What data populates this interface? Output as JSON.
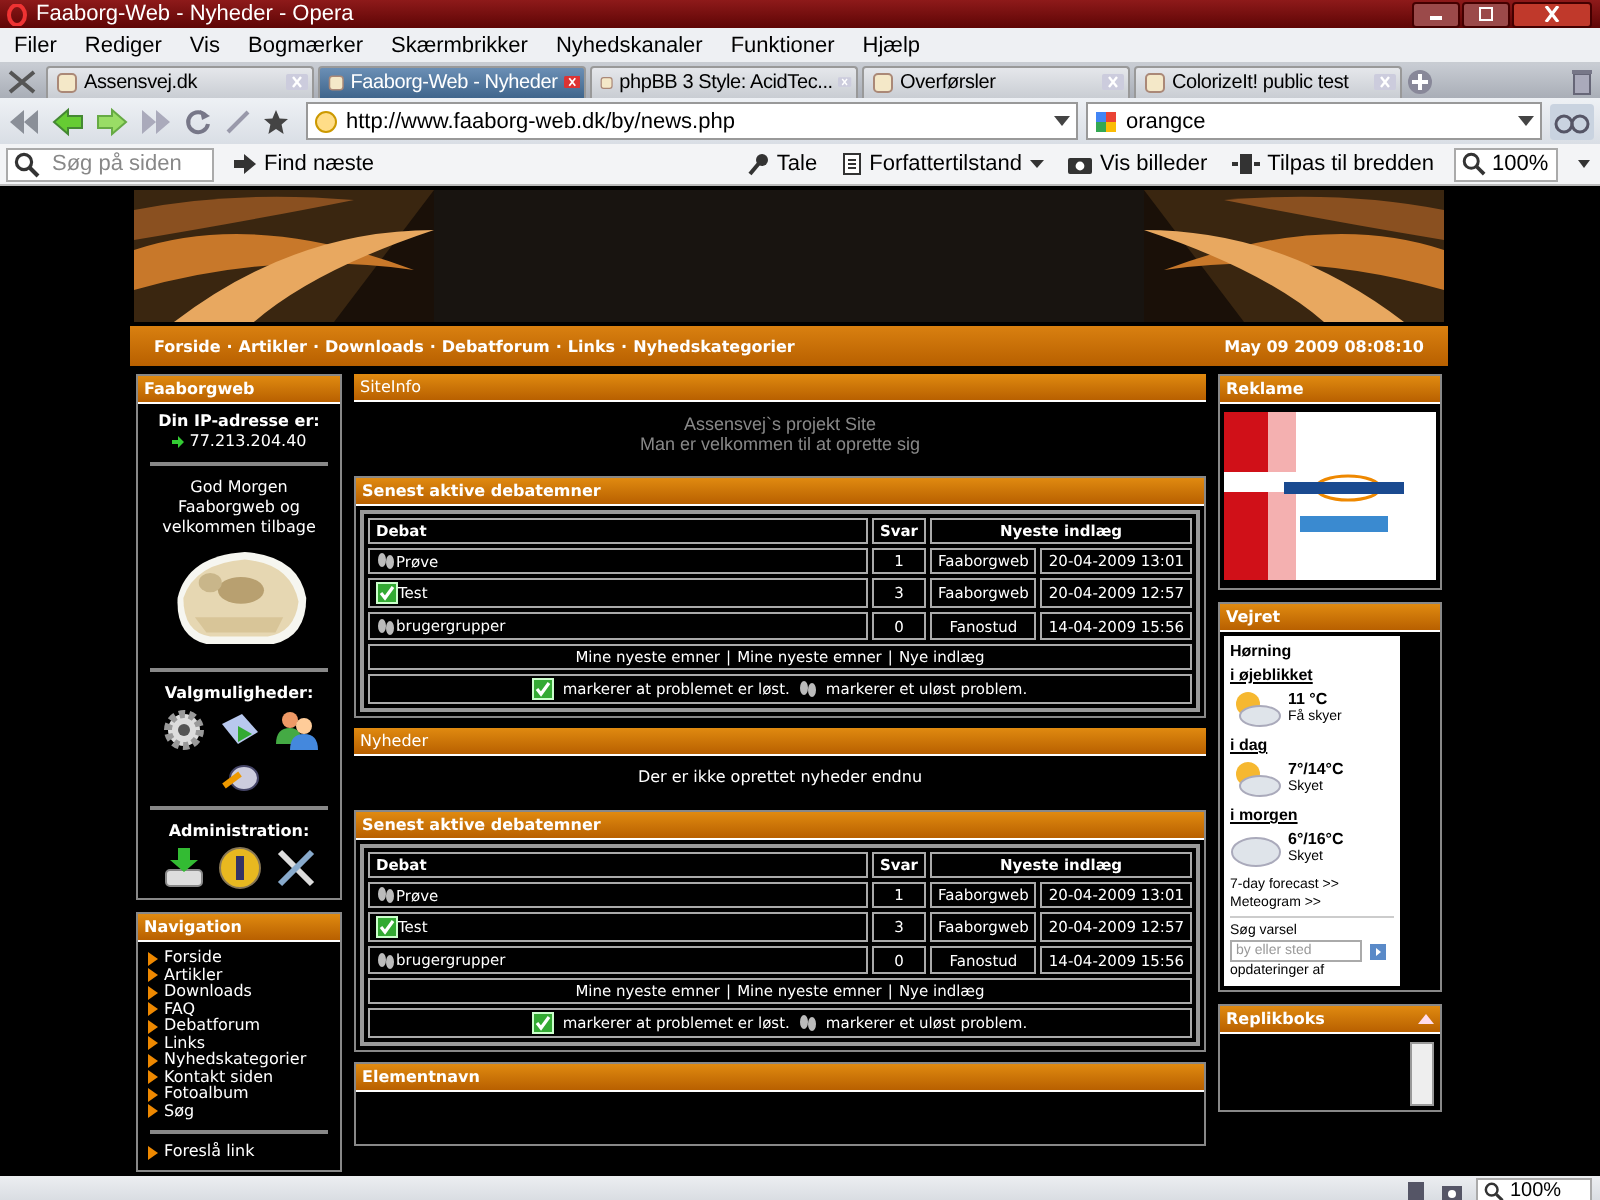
{
  "window": {
    "title": "Faaborg-Web - Nyheder - Opera"
  },
  "menu": [
    "Filer",
    "Rediger",
    "Vis",
    "Bogmærker",
    "Skærmbrikker",
    "Nyhedskanaler",
    "Funktioner",
    "Hjælp"
  ],
  "tabs": [
    {
      "label": "Assensvej.dk",
      "selected": false
    },
    {
      "label": "Faaborg-Web - Nyheder",
      "selected": true
    },
    {
      "label": "phpBB 3 Style: AcidTec...",
      "selected": false
    },
    {
      "label": "Overførsler",
      "selected": false
    },
    {
      "label": "ColorizeIt! public test",
      "selected": false
    }
  ],
  "address": {
    "url": "http://www.faaborg-web.dk/by/news.php",
    "search": "orangce"
  },
  "findbar": {
    "placeholder": "Søg på siden",
    "find_next": "Find næste",
    "speak": "Tale",
    "author_mode": "Forfattertilstand",
    "images": "Vis billeder",
    "fit": "Tilpas til bredden",
    "zoom": "100%"
  },
  "site": {
    "nav": [
      "Forside",
      "Artikler",
      "Downloads",
      "Debatforum",
      "Links",
      "Nyhedskategorier"
    ],
    "separator": "·",
    "datetime": "May 09 2009 08:08:10"
  },
  "user_panel": {
    "title": "Faaborgweb",
    "ip_label": "Din IP-adresse er:",
    "ip": "77.213.204.40",
    "greeting": "God Morgen Faaborgweb og velkommen tilbage",
    "options_title": "Valgmuligheder:",
    "admin_title": "Administration:"
  },
  "navigation": {
    "title": "Navigation",
    "links": [
      "Forside",
      "Artikler",
      "Downloads",
      "FAQ",
      "Debatforum",
      "Links",
      "Nyhedskategorier",
      "Kontakt siden",
      "Fotoalbum",
      "Søg"
    ],
    "extra_links": [
      "Foreslå link"
    ]
  },
  "panels": [
    {
      "kind": "text",
      "title": "SiteInfo",
      "lines": [
        "Assensvej`s projekt Site",
        "Man er velkommen til at oprette sig"
      ],
      "muted": true
    },
    {
      "kind": "forum",
      "title": "Senest aktive debatemner",
      "columns": [
        "Debat",
        "Svar",
        "Nyeste indlæg"
      ],
      "rows": [
        {
          "topic": "Prøve",
          "solved": false,
          "replies": "1",
          "author": "Faaborgweb",
          "date": "20-04-2009 13:01"
        },
        {
          "topic": "Test",
          "solved": true,
          "replies": "3",
          "author": "Faaborgweb",
          "date": "20-04-2009 12:57"
        },
        {
          "topic": "brugergrupper",
          "solved": false,
          "replies": "0",
          "author": "Fanostud",
          "date": "14-04-2009 15:56"
        }
      ],
      "links": [
        "Mine nyeste emner",
        "Mine nyeste emner",
        "Nye indlæg"
      ],
      "link_separator": "|",
      "legend_solved": "markerer at problemet er løst.",
      "legend_unsolved": "markerer et uløst problem."
    },
    {
      "kind": "text",
      "title": "Nyheder",
      "lines": [
        "Der er ikke oprettet nyheder endnu"
      ],
      "muted": false
    },
    {
      "kind": "forum",
      "title": "Senest aktive debatemner",
      "columns": [
        "Debat",
        "Svar",
        "Nyeste indlæg"
      ],
      "rows": [
        {
          "topic": "Prøve",
          "solved": false,
          "replies": "1",
          "author": "Faaborgweb",
          "date": "20-04-2009 13:01"
        },
        {
          "topic": "Test",
          "solved": true,
          "replies": "3",
          "author": "Faaborgweb",
          "date": "20-04-2009 12:57"
        },
        {
          "topic": "brugergrupper",
          "solved": false,
          "replies": "0",
          "author": "Fanostud",
          "date": "14-04-2009 15:56"
        }
      ],
      "links": [
        "Mine nyeste emner",
        "Mine nyeste emner",
        "Nye indlæg"
      ],
      "link_separator": "|",
      "legend_solved": "markerer at problemet er løst.",
      "legend_unsolved": "markerer et uløst problem."
    },
    {
      "kind": "header",
      "title": "Elementnavn"
    }
  ],
  "ad": {
    "title": "Reklame"
  },
  "weather": {
    "title": "Vejret",
    "place": "Hørning",
    "periods": [
      {
        "label": "i øjeblikket",
        "temp": "11 °C",
        "desc": "Få skyer",
        "kind": "sun-cloud"
      },
      {
        "label": "i dag",
        "temp": "7°/14°C",
        "desc": "Skyet",
        "kind": "sun-cloud"
      },
      {
        "label": "i morgen",
        "temp": "6°/16°C",
        "desc": "Skyet",
        "kind": "cloud"
      }
    ],
    "links": [
      "7-day forecast >>",
      "Meteogram >>"
    ],
    "search_label": "Søg varsel",
    "placeholder": "by eller sted",
    "footer": "opdateringer af"
  },
  "shoutbox": {
    "title": "Replikboks"
  },
  "status_bar": {
    "zoom": "100%"
  }
}
